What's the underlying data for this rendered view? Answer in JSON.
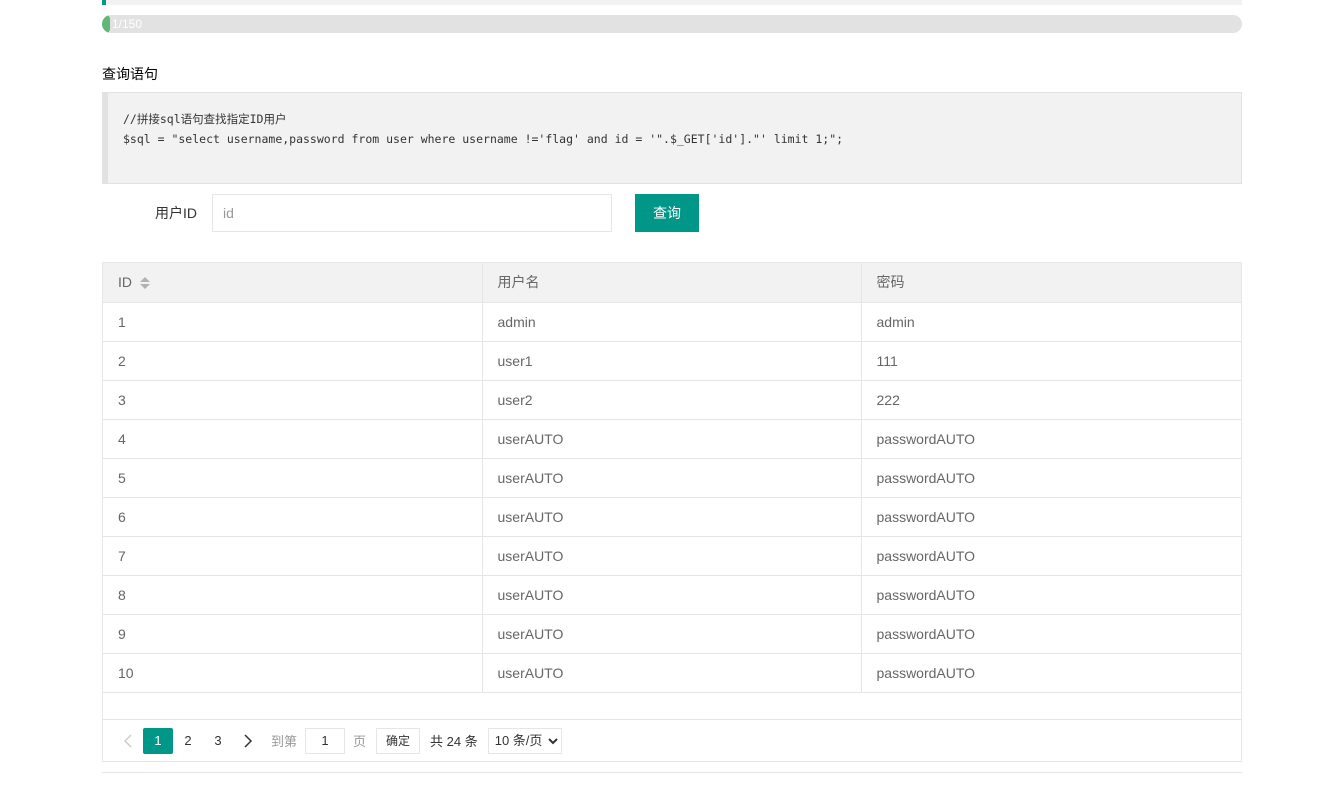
{
  "progress": {
    "text": "1/150",
    "current": 1,
    "total": 150
  },
  "section": {
    "title": "查询语句"
  },
  "code": {
    "line1": "//拼接sql语句查找指定ID用户",
    "line2": "$sql = \"select username,password from user where username !='flag' and id = '\".$_GET['id'].\"' limit 1;\";"
  },
  "form": {
    "label": "用户ID",
    "input_value": "",
    "input_placeholder": "id",
    "button_label": "查询"
  },
  "table": {
    "columns": [
      "ID",
      "用户名",
      "密码"
    ],
    "rows": [
      [
        "1",
        "admin",
        "admin"
      ],
      [
        "2",
        "user1",
        "111"
      ],
      [
        "3",
        "user2",
        "222"
      ],
      [
        "4",
        "userAUTO",
        "passwordAUTO"
      ],
      [
        "5",
        "userAUTO",
        "passwordAUTO"
      ],
      [
        "6",
        "userAUTO",
        "passwordAUTO"
      ],
      [
        "7",
        "userAUTO",
        "passwordAUTO"
      ],
      [
        "8",
        "userAUTO",
        "passwordAUTO"
      ],
      [
        "9",
        "userAUTO",
        "passwordAUTO"
      ],
      [
        "10",
        "userAUTO",
        "passwordAUTO"
      ]
    ]
  },
  "pager": {
    "pages": [
      "1",
      "2",
      "3"
    ],
    "current_page": "1",
    "goto_prefix": "到第",
    "goto_value": "1",
    "goto_suffix": "页",
    "confirm_label": "确定",
    "total_text": "共 24 条",
    "page_size_selected": "10 条/页"
  },
  "colors": {
    "accent": "#009688",
    "progress": "#5fb878"
  },
  "icons": {
    "sort": "sort-icon",
    "prev": "chevron-left-icon",
    "next": "chevron-right-icon"
  }
}
